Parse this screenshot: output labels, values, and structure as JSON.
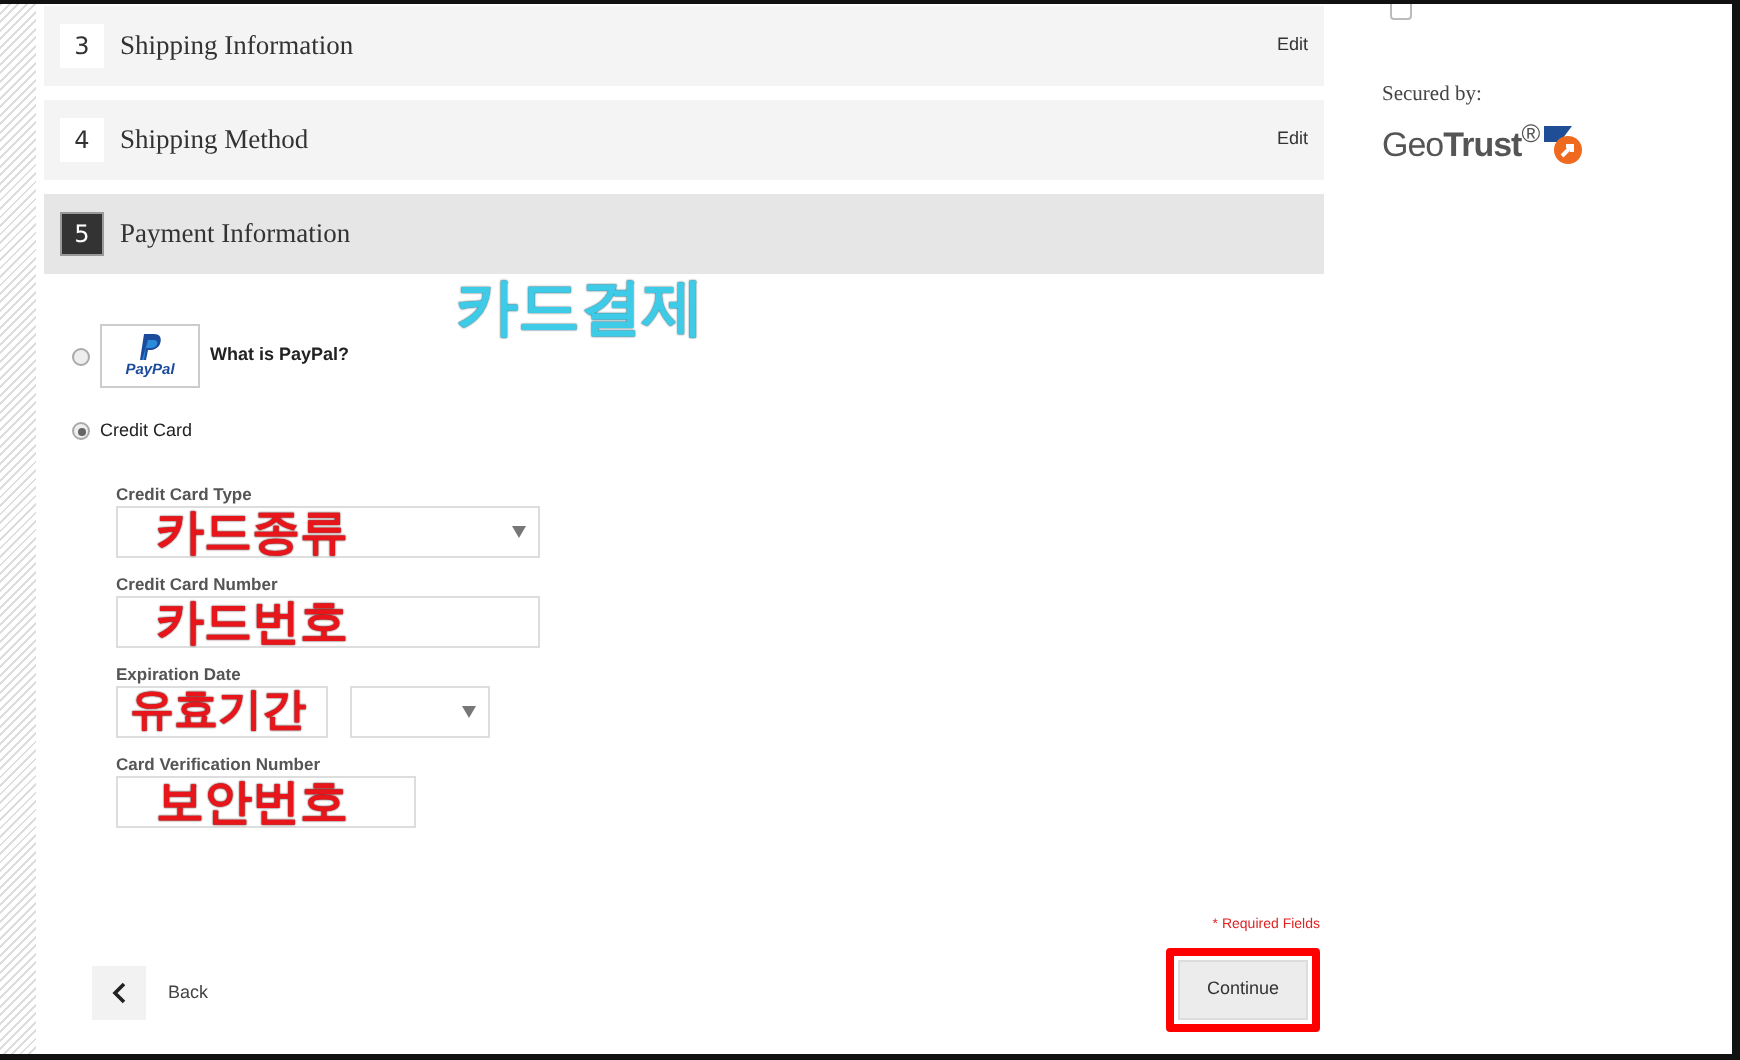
{
  "steps": [
    {
      "number": "3",
      "title": "Shipping Information",
      "edit": "Edit",
      "selected": false
    },
    {
      "number": "4",
      "title": "Shipping Method",
      "edit": "Edit",
      "selected": false
    },
    {
      "number": "5",
      "title": "Payment Information",
      "selected": true
    }
  ],
  "payment_note": "카드결제",
  "payment_methods": [
    {
      "kind": "paypal",
      "logo_text": "PayPal",
      "label": "What is PayPal?",
      "selected": false
    },
    {
      "kind": "card",
      "label": "Credit Card",
      "selected": true
    }
  ],
  "card_form": [
    {
      "kind": "select",
      "label": "Credit Card Type",
      "annotation": "카드종류"
    },
    {
      "kind": "text",
      "label": "Credit Card Number",
      "annotation": "카드번호"
    },
    {
      "kind": "date",
      "label": "Expiration Date",
      "annotation": "유효기간"
    },
    {
      "kind": "text",
      "label": "Card Verification Number",
      "annotation": "보안번호",
      "narrow": true
    }
  ],
  "required_note": "* Required Fields",
  "back": "Back",
  "continue": {
    "label": "Continue",
    "highlighted": true
  },
  "sidebar": {
    "checkbox_checked": false,
    "secured_by": "Secured by:",
    "seal": "Geo**Trust**$^{®}$"
  }
}
